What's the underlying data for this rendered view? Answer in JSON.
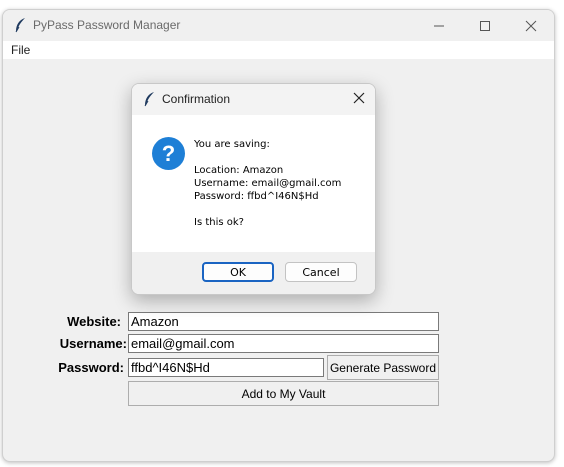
{
  "window": {
    "title": "PyPass Password Manager"
  },
  "menu": {
    "file_label": "File"
  },
  "form": {
    "website_label": "Website:",
    "website_value": "Amazon",
    "username_label": "Username:",
    "username_value": "email@gmail.com",
    "password_label": "Password:",
    "password_value": "ffbd^I46N$Hd",
    "generate_button": "Generate Password",
    "add_button": "Add to My Vault"
  },
  "dialog": {
    "title": "Confirmation",
    "icon": "question-icon",
    "heading": "You are saving:",
    "location_line": "Location: Amazon",
    "username_line": "Username: email@gmail.com",
    "password_line": "Password: ffbd^I46N$Hd",
    "question": "Is this ok?",
    "ok_label": "OK",
    "cancel_label": "Cancel"
  },
  "colors": {
    "accent": "#1a64c2",
    "info_icon": "#1e7fd6"
  }
}
